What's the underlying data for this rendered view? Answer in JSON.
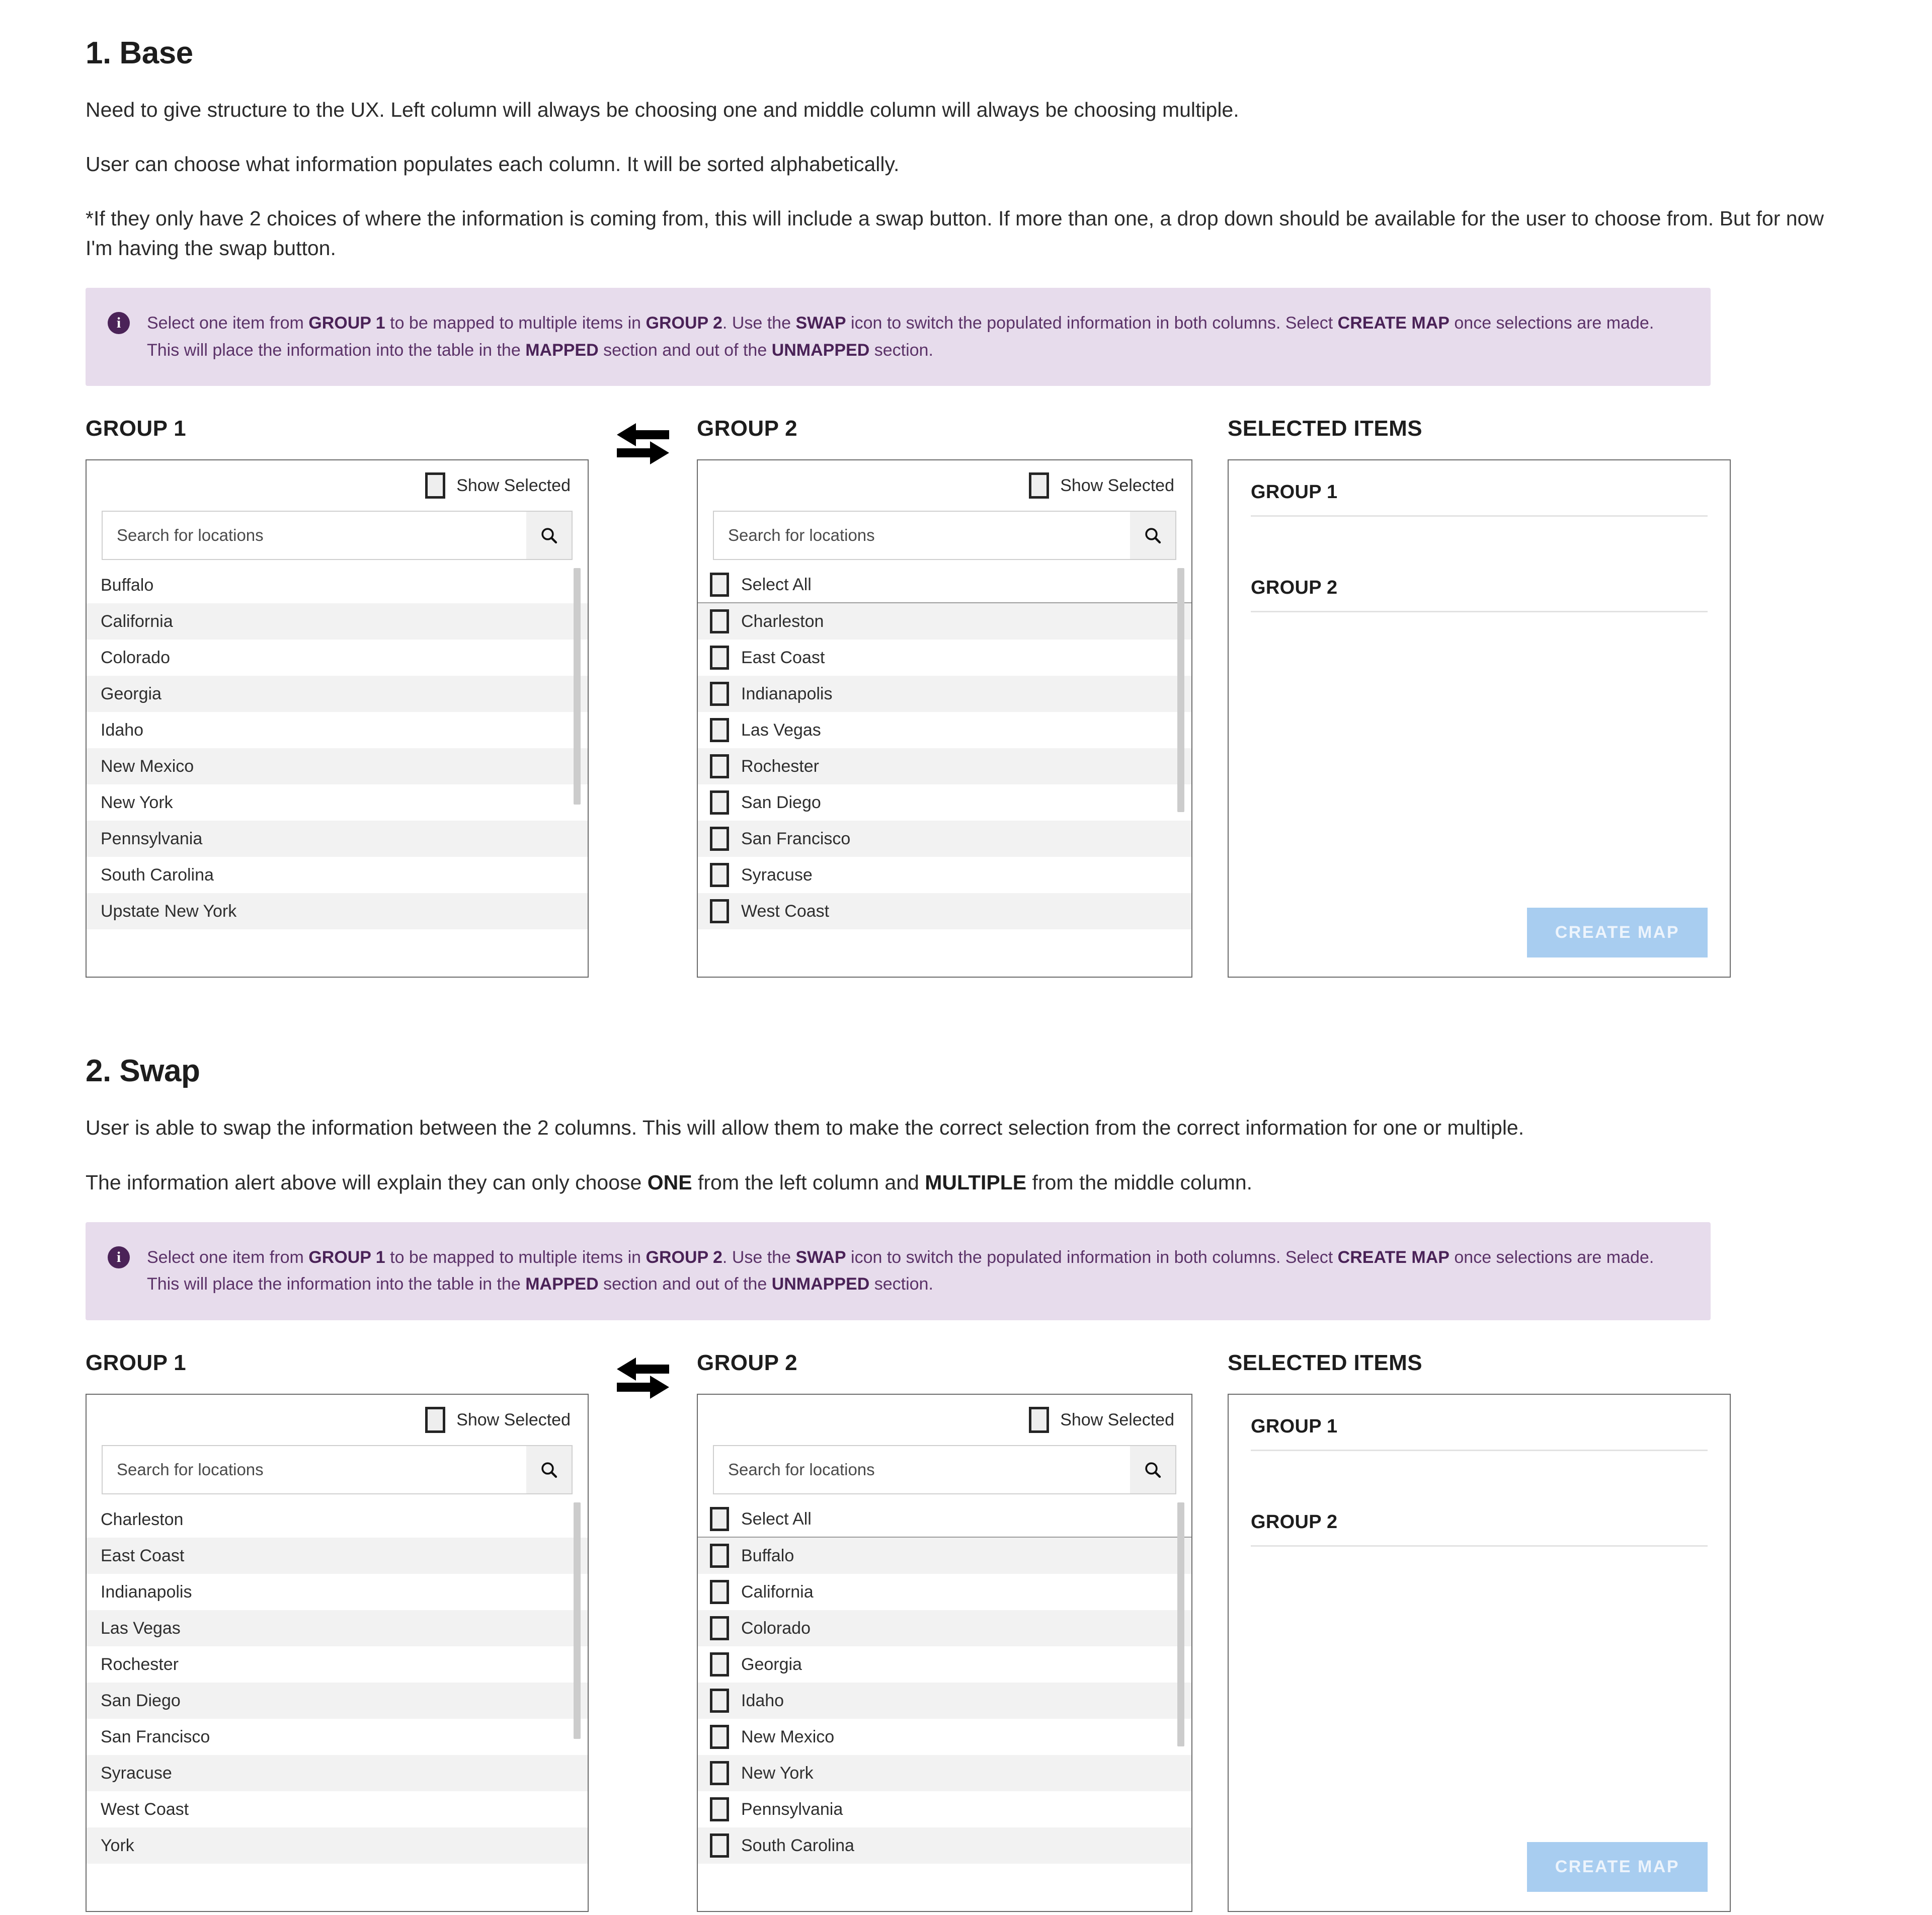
{
  "sections": [
    {
      "heading": "1. Base",
      "paragraphs": [
        "Need to give structure to the UX. Left column will always be choosing one and middle column will always be choosing multiple.",
        "User can choose what information populates each column. It will be sorted alphabetically.",
        "*If they only have 2 choices of where the information is coming from, this will include a swap button. If more than one, a drop down should be available for the user to choose from. But for now I'm having the swap button."
      ],
      "group1_items": [
        "Buffalo",
        "California",
        "Colorado",
        "Georgia",
        "Idaho",
        "New Mexico",
        "New York",
        "Pennsylvania",
        "South Carolina",
        "Upstate New York"
      ],
      "group2_items": [
        "Charleston",
        "East Coast",
        "Indianapolis",
        "Las Vegas",
        "Rochester",
        "San Diego",
        "San Francisco",
        "Syracuse",
        "West Coast"
      ]
    },
    {
      "heading": "2. Swap",
      "paragraphs": [
        "User is able to swap the information between the 2 columns. This will allow them to make the correct selection from the correct information for one or multiple.",
        "The information alert above will explain they can only choose ONE from the left column and MULTIPLE from the middle column."
      ],
      "group1_items": [
        "Charleston",
        "East Coast",
        "Indianapolis",
        "Las Vegas",
        "Rochester",
        "San Diego",
        "San Francisco",
        "Syracuse",
        "West Coast",
        "York"
      ],
      "group2_items": [
        "Buffalo",
        "California",
        "Colorado",
        "Georgia",
        "Idaho",
        "New Mexico",
        "New York",
        "Pennsylvania",
        "South Carolina"
      ]
    }
  ],
  "alert": {
    "p1_a": "Select one item from ",
    "p1_b1": "GROUP 1",
    "p1_c": " to be mapped to multiple items in ",
    "p1_b2": "GROUP 2",
    "p1_d": ". Use the ",
    "p1_b3": "SWAP",
    "p1_e": " icon to switch the populated information in both columns. Select ",
    "p1_b4": "CREATE MAP",
    "p1_f": " once selections are made. This will place the information into the table in the ",
    "p1_b5": "MAPPED",
    "p1_g": " section and out of the ",
    "p1_b6": "UNMAPPED",
    "p1_h": " section."
  },
  "labels": {
    "group1_heading": "GROUP 1",
    "group2_heading": "GROUP 2",
    "selected_items_heading": "SELECTED ITEMS",
    "show_selected": "Show Selected",
    "search_placeholder": "Search for locations",
    "select_all": "Select All",
    "create_map": "CREATE MAP",
    "selected_group1": "GROUP 1",
    "selected_group2": "GROUP 2"
  },
  "colors": {
    "alert_bg": "#e7dcec",
    "alert_text": "#5b3268",
    "alert_icon_bg": "#4b2358",
    "create_map_bg": "#a8cdf0",
    "panel_border": "#6a6a6a",
    "row_alt": "#f2f2f2"
  },
  "para2_section2": {
    "a": "The information alert above will explain they can only choose ",
    "b1": "ONE",
    "c": " from the left column and ",
    "b2": "MULTIPLE",
    "d": " from the middle column."
  }
}
